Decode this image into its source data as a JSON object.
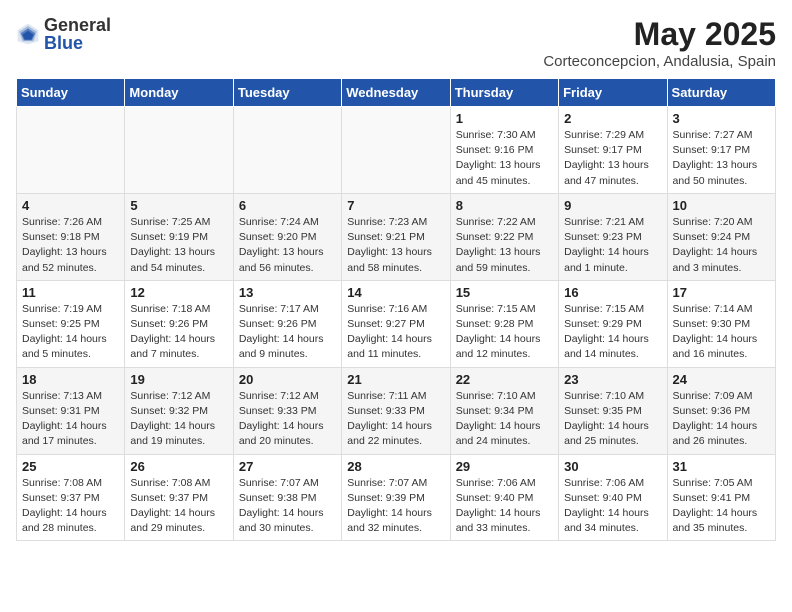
{
  "logo": {
    "general": "General",
    "blue": "Blue"
  },
  "title": "May 2025",
  "location": "Corteconcepcion, Andalusia, Spain",
  "days_of_week": [
    "Sunday",
    "Monday",
    "Tuesday",
    "Wednesday",
    "Thursday",
    "Friday",
    "Saturday"
  ],
  "weeks": [
    [
      {
        "day": "",
        "info": ""
      },
      {
        "day": "",
        "info": ""
      },
      {
        "day": "",
        "info": ""
      },
      {
        "day": "",
        "info": ""
      },
      {
        "day": "1",
        "info": "Sunrise: 7:30 AM\nSunset: 9:16 PM\nDaylight: 13 hours\nand 45 minutes."
      },
      {
        "day": "2",
        "info": "Sunrise: 7:29 AM\nSunset: 9:17 PM\nDaylight: 13 hours\nand 47 minutes."
      },
      {
        "day": "3",
        "info": "Sunrise: 7:27 AM\nSunset: 9:17 PM\nDaylight: 13 hours\nand 50 minutes."
      }
    ],
    [
      {
        "day": "4",
        "info": "Sunrise: 7:26 AM\nSunset: 9:18 PM\nDaylight: 13 hours\nand 52 minutes."
      },
      {
        "day": "5",
        "info": "Sunrise: 7:25 AM\nSunset: 9:19 PM\nDaylight: 13 hours\nand 54 minutes."
      },
      {
        "day": "6",
        "info": "Sunrise: 7:24 AM\nSunset: 9:20 PM\nDaylight: 13 hours\nand 56 minutes."
      },
      {
        "day": "7",
        "info": "Sunrise: 7:23 AM\nSunset: 9:21 PM\nDaylight: 13 hours\nand 58 minutes."
      },
      {
        "day": "8",
        "info": "Sunrise: 7:22 AM\nSunset: 9:22 PM\nDaylight: 13 hours\nand 59 minutes."
      },
      {
        "day": "9",
        "info": "Sunrise: 7:21 AM\nSunset: 9:23 PM\nDaylight: 14 hours\nand 1 minute."
      },
      {
        "day": "10",
        "info": "Sunrise: 7:20 AM\nSunset: 9:24 PM\nDaylight: 14 hours\nand 3 minutes."
      }
    ],
    [
      {
        "day": "11",
        "info": "Sunrise: 7:19 AM\nSunset: 9:25 PM\nDaylight: 14 hours\nand 5 minutes."
      },
      {
        "day": "12",
        "info": "Sunrise: 7:18 AM\nSunset: 9:26 PM\nDaylight: 14 hours\nand 7 minutes."
      },
      {
        "day": "13",
        "info": "Sunrise: 7:17 AM\nSunset: 9:26 PM\nDaylight: 14 hours\nand 9 minutes."
      },
      {
        "day": "14",
        "info": "Sunrise: 7:16 AM\nSunset: 9:27 PM\nDaylight: 14 hours\nand 11 minutes."
      },
      {
        "day": "15",
        "info": "Sunrise: 7:15 AM\nSunset: 9:28 PM\nDaylight: 14 hours\nand 12 minutes."
      },
      {
        "day": "16",
        "info": "Sunrise: 7:15 AM\nSunset: 9:29 PM\nDaylight: 14 hours\nand 14 minutes."
      },
      {
        "day": "17",
        "info": "Sunrise: 7:14 AM\nSunset: 9:30 PM\nDaylight: 14 hours\nand 16 minutes."
      }
    ],
    [
      {
        "day": "18",
        "info": "Sunrise: 7:13 AM\nSunset: 9:31 PM\nDaylight: 14 hours\nand 17 minutes."
      },
      {
        "day": "19",
        "info": "Sunrise: 7:12 AM\nSunset: 9:32 PM\nDaylight: 14 hours\nand 19 minutes."
      },
      {
        "day": "20",
        "info": "Sunrise: 7:12 AM\nSunset: 9:33 PM\nDaylight: 14 hours\nand 20 minutes."
      },
      {
        "day": "21",
        "info": "Sunrise: 7:11 AM\nSunset: 9:33 PM\nDaylight: 14 hours\nand 22 minutes."
      },
      {
        "day": "22",
        "info": "Sunrise: 7:10 AM\nSunset: 9:34 PM\nDaylight: 14 hours\nand 24 minutes."
      },
      {
        "day": "23",
        "info": "Sunrise: 7:10 AM\nSunset: 9:35 PM\nDaylight: 14 hours\nand 25 minutes."
      },
      {
        "day": "24",
        "info": "Sunrise: 7:09 AM\nSunset: 9:36 PM\nDaylight: 14 hours\nand 26 minutes."
      }
    ],
    [
      {
        "day": "25",
        "info": "Sunrise: 7:08 AM\nSunset: 9:37 PM\nDaylight: 14 hours\nand 28 minutes."
      },
      {
        "day": "26",
        "info": "Sunrise: 7:08 AM\nSunset: 9:37 PM\nDaylight: 14 hours\nand 29 minutes."
      },
      {
        "day": "27",
        "info": "Sunrise: 7:07 AM\nSunset: 9:38 PM\nDaylight: 14 hours\nand 30 minutes."
      },
      {
        "day": "28",
        "info": "Sunrise: 7:07 AM\nSunset: 9:39 PM\nDaylight: 14 hours\nand 32 minutes."
      },
      {
        "day": "29",
        "info": "Sunrise: 7:06 AM\nSunset: 9:40 PM\nDaylight: 14 hours\nand 33 minutes."
      },
      {
        "day": "30",
        "info": "Sunrise: 7:06 AM\nSunset: 9:40 PM\nDaylight: 14 hours\nand 34 minutes."
      },
      {
        "day": "31",
        "info": "Sunrise: 7:05 AM\nSunset: 9:41 PM\nDaylight: 14 hours\nand 35 minutes."
      }
    ]
  ]
}
